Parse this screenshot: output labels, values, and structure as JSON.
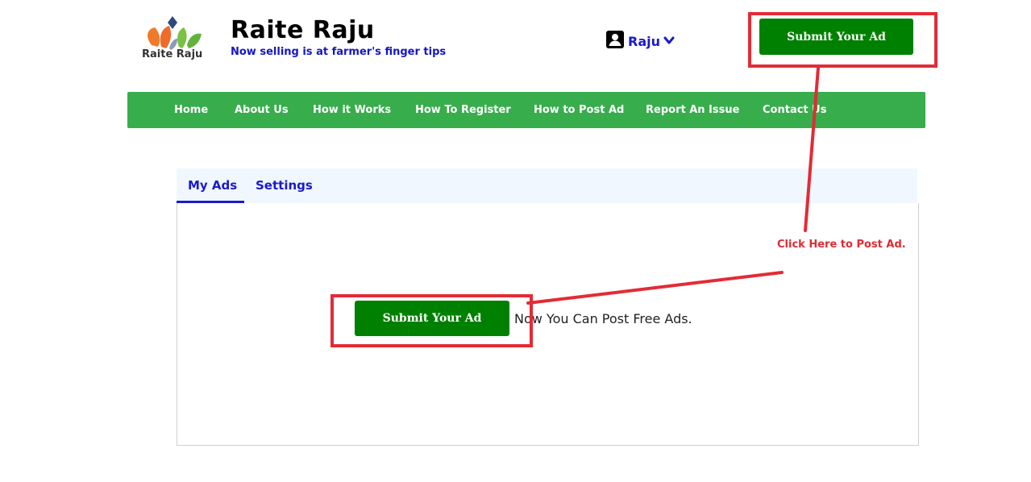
{
  "header": {
    "logo_text": "Raite Raju",
    "title": "Raite Raju",
    "tagline": "Now selling is at farmer's finger tips",
    "user_name": "Raju",
    "submit_label": "Submit Your Ad"
  },
  "nav": {
    "items": [
      {
        "label": "Home"
      },
      {
        "label": "About Us"
      },
      {
        "label": "How it Works"
      },
      {
        "label": "How To Register"
      },
      {
        "label": "How to Post Ad"
      },
      {
        "label": "Report An Issue"
      },
      {
        "label": "Contact Us"
      }
    ]
  },
  "tabs": [
    {
      "label": "My Ads",
      "active": true
    },
    {
      "label": "Settings",
      "active": false
    }
  ],
  "main": {
    "submit_label": "Submit Your Ad",
    "message": "Now You Can Post Free Ads."
  },
  "annotation": {
    "text": "Click Here to Post Ad.",
    "color": "#e32b35"
  },
  "colors": {
    "nav_bg": "#37ad4c",
    "button_bg": "#008000",
    "link_blue": "#1a1acc"
  }
}
